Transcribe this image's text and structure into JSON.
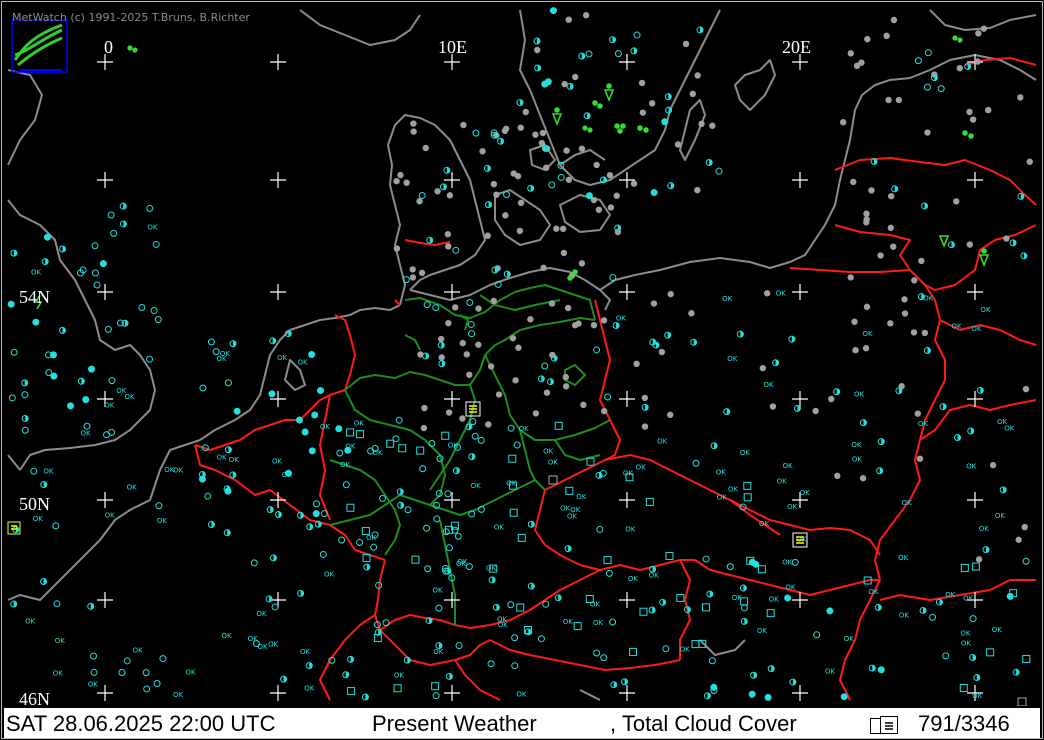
{
  "copyright": "MetWatch  (c) 1991-2025 T.Bruns, B.Richter",
  "longitude_labels": [
    "0",
    "10E",
    "20E"
  ],
  "latitude_labels": [
    "54N",
    "50N",
    "46N"
  ],
  "status": {
    "datetime": "SAT 28.06.2025 22:00 UTC",
    "product": "Present Weather",
    "overlay": ", Total Cloud Cover",
    "count": "791/3346"
  },
  "station_ok_label": "OK",
  "colors": {
    "background": "#000000",
    "coastline": "#8c8c8c",
    "border_country": "#ff1a1a",
    "border_state": "#1e8c1e",
    "cloud_station": "#22e0e0",
    "overcast_station": "#a0a0a0",
    "weather_symbol": "#33dd33",
    "statusbar_bg": "#ffffff"
  },
  "icons": [
    "metwatch-logo-icon",
    "grid-cross-icon",
    "cloud-cover-station-icon",
    "drizzle-symbol-icon",
    "rain-shower-symbol-icon",
    "fog-symbol-icon"
  ]
}
